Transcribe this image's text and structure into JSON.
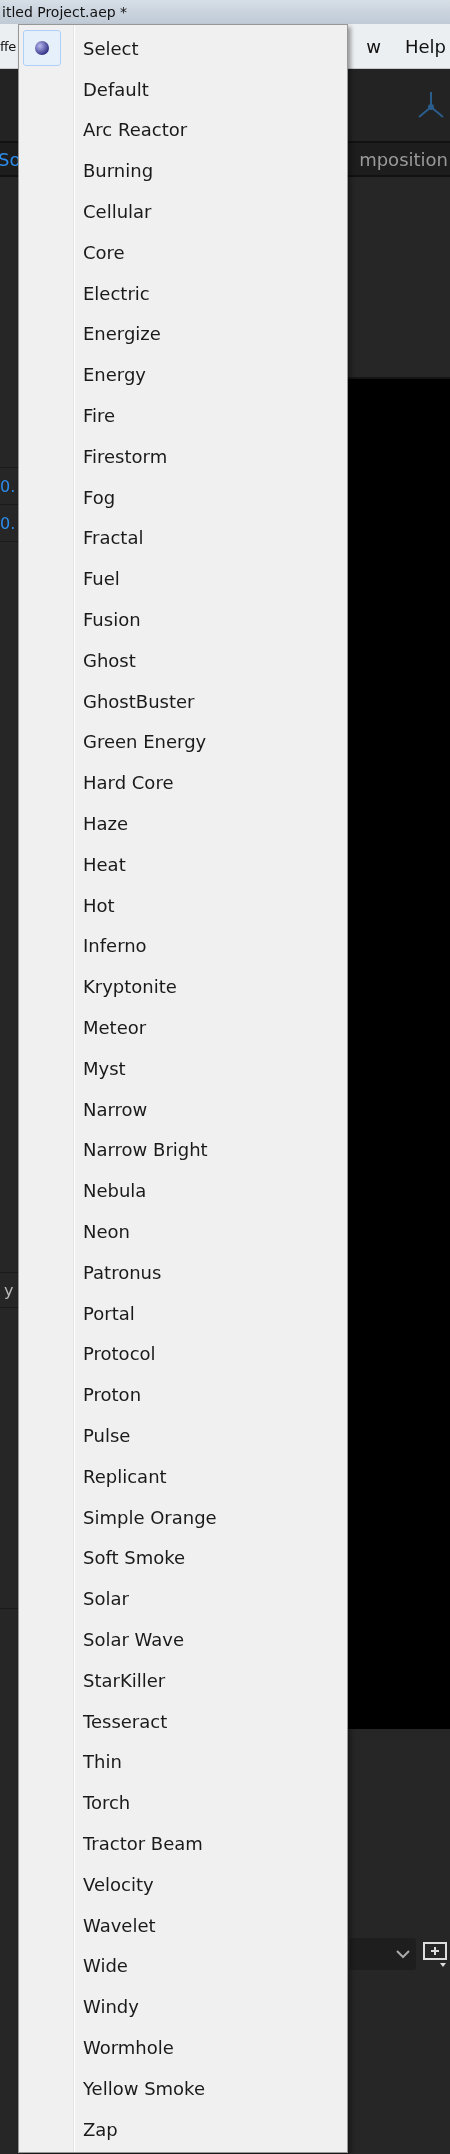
{
  "window": {
    "title": "itled Project.aep *"
  },
  "menu_bar": {
    "left_fragment": "ffe",
    "right_items": [
      "w",
      "Help"
    ]
  },
  "panel_tab": {
    "left_fragment": "So",
    "right_fragment": "mposition"
  },
  "left_values": [
    "0.",
    "0."
  ],
  "left_label": "y",
  "effect_menu": {
    "items": [
      {
        "label": "Select",
        "selected": true
      },
      {
        "label": "Default",
        "selected": false
      },
      {
        "label": "Arc Reactor",
        "selected": false
      },
      {
        "label": "Burning",
        "selected": false
      },
      {
        "label": "Cellular",
        "selected": false
      },
      {
        "label": "Core",
        "selected": false
      },
      {
        "label": "Electric",
        "selected": false
      },
      {
        "label": "Energize",
        "selected": false
      },
      {
        "label": "Energy",
        "selected": false
      },
      {
        "label": "Fire",
        "selected": false
      },
      {
        "label": "Firestorm",
        "selected": false
      },
      {
        "label": "Fog",
        "selected": false
      },
      {
        "label": "Fractal",
        "selected": false
      },
      {
        "label": "Fuel",
        "selected": false
      },
      {
        "label": "Fusion",
        "selected": false
      },
      {
        "label": "Ghost",
        "selected": false
      },
      {
        "label": "GhostBuster",
        "selected": false
      },
      {
        "label": "Green Energy",
        "selected": false
      },
      {
        "label": "Hard Core",
        "selected": false
      },
      {
        "label": "Haze",
        "selected": false
      },
      {
        "label": "Heat",
        "selected": false
      },
      {
        "label": "Hot",
        "selected": false
      },
      {
        "label": "Inferno",
        "selected": false
      },
      {
        "label": "Kryptonite",
        "selected": false
      },
      {
        "label": "Meteor",
        "selected": false
      },
      {
        "label": "Myst",
        "selected": false
      },
      {
        "label": "Narrow",
        "selected": false
      },
      {
        "label": "Narrow Bright",
        "selected": false
      },
      {
        "label": "Nebula",
        "selected": false
      },
      {
        "label": "Neon",
        "selected": false
      },
      {
        "label": "Patronus",
        "selected": false
      },
      {
        "label": "Portal",
        "selected": false
      },
      {
        "label": "Protocol",
        "selected": false
      },
      {
        "label": "Proton",
        "selected": false
      },
      {
        "label": "Pulse",
        "selected": false
      },
      {
        "label": "Replicant",
        "selected": false
      },
      {
        "label": "Simple Orange",
        "selected": false
      },
      {
        "label": "Soft Smoke",
        "selected": false
      },
      {
        "label": "Solar",
        "selected": false
      },
      {
        "label": "Solar Wave",
        "selected": false
      },
      {
        "label": "StarKiller",
        "selected": false
      },
      {
        "label": "Tesseract",
        "selected": false
      },
      {
        "label": "Thin",
        "selected": false
      },
      {
        "label": "Torch",
        "selected": false
      },
      {
        "label": "Tractor Beam",
        "selected": false
      },
      {
        "label": "Velocity",
        "selected": false
      },
      {
        "label": "Wavelet",
        "selected": false
      },
      {
        "label": "Wide",
        "selected": false
      },
      {
        "label": "Windy",
        "selected": false
      },
      {
        "label": "Wormhole",
        "selected": false
      },
      {
        "label": "Yellow Smoke",
        "selected": false
      },
      {
        "label": "Zap",
        "selected": false
      }
    ]
  }
}
